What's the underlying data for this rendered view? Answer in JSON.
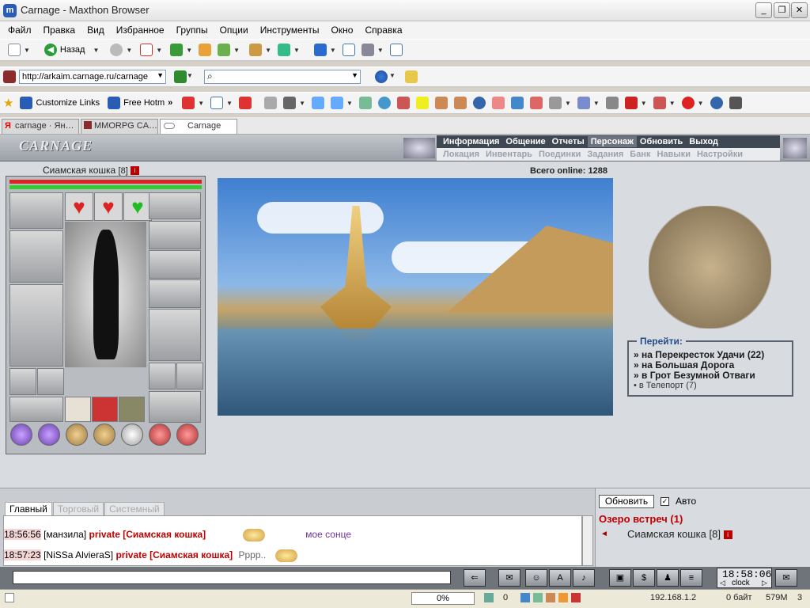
{
  "window": {
    "title": "Carnage - Maxthon Browser",
    "app_icon": "m"
  },
  "menu": [
    "Файл",
    "Правка",
    "Вид",
    "Избранное",
    "Группы",
    "Опции",
    "Инструменты",
    "Окно",
    "Справка"
  ],
  "toolbar": {
    "back_label": "Назад"
  },
  "address": {
    "url": "http://arkaim.carnage.ru/carnage"
  },
  "links": {
    "customize": "Customize Links",
    "freehotmail": "Free Hotm"
  },
  "tabs": [
    "carnage · Ян…",
    "MMORPG CA…",
    "Carnage"
  ],
  "game": {
    "logo": "CARNAGE",
    "nav_top": [
      "Информация",
      "Общение",
      "Отчеты",
      "Персонаж",
      "Обновить",
      "Выход"
    ],
    "nav_top_selected": "Персонаж",
    "nav_sub": [
      "Локация",
      "Инвентарь",
      "Поединки",
      "Задания",
      "Банк",
      "Навыки",
      "Настройки"
    ],
    "character": {
      "name": "Сиамская кошка",
      "level": "[8]"
    },
    "online": "Всего online: 1288",
    "goto": {
      "title": "Перейти:",
      "items": [
        "» на Перекресток Удачи (22)",
        "» на Большая Дорога",
        "» в Грот Безумной Отваги"
      ],
      "teleport": "• в Телепорт (7)"
    }
  },
  "chat": {
    "tabs": [
      "Главный",
      "Торговый",
      "Системный"
    ],
    "messages": [
      {
        "time": "18:56:56",
        "user": "[манзила]",
        "priv": "private [Сиамская кошка]",
        "text": "мое сонце"
      },
      {
        "time": "18:57:23",
        "user": "[NiSSa AlvieraS]",
        "priv": "private [Сиамская кошка]",
        "text": "Рррр.."
      }
    ]
  },
  "room": {
    "update": "Обновить",
    "auto": "Авто",
    "name": "Озеро встреч (1)",
    "user": "Сиамская кошка",
    "user_level": "[8]"
  },
  "clock": {
    "time": "18:58:06",
    "label": "clock"
  },
  "status": {
    "progress": "0%",
    "count": "0",
    "ip": "192.168.1.2",
    "bytes": "0 байт",
    "mem": "579M",
    "num": "3"
  }
}
